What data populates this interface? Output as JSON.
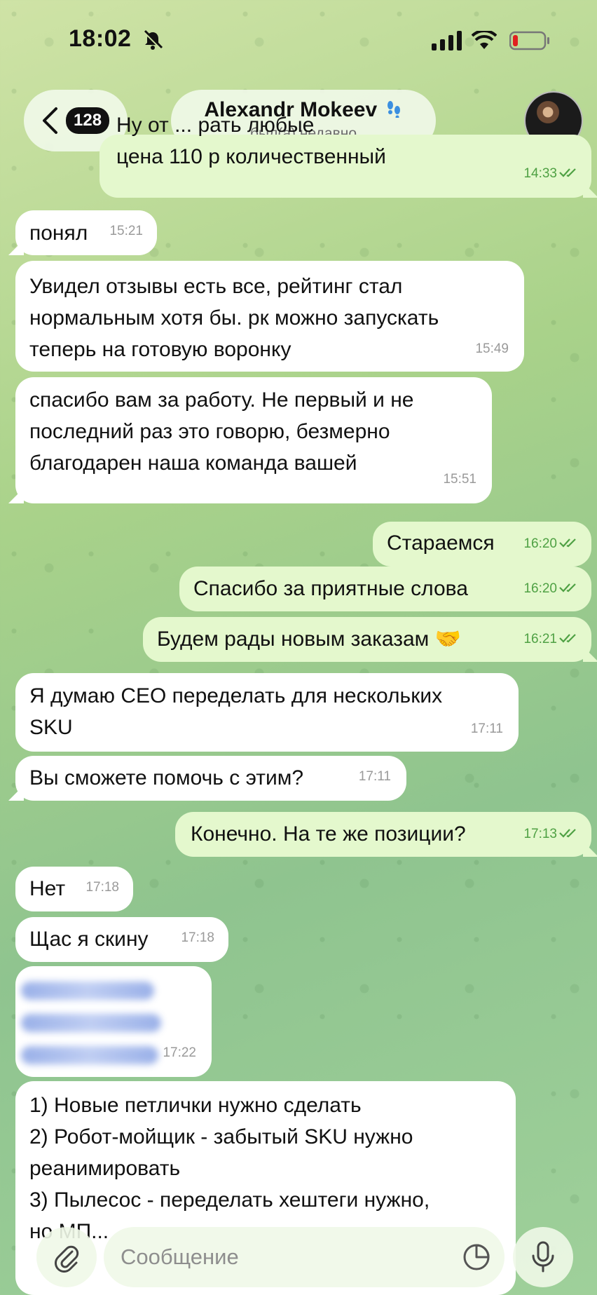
{
  "status_bar": {
    "time": "18:02"
  },
  "header": {
    "back_count": "128",
    "chat_name": "Alexandr Mokeev",
    "chat_status": "был(а) недавно"
  },
  "messages": [
    {
      "dir": "out",
      "text": "Ну от ... рать любые\nцена 110 р количественный",
      "time": "14:33"
    },
    {
      "dir": "in",
      "text": "понял",
      "time": "15:21"
    },
    {
      "dir": "in",
      "text": "Увидел отзывы есть все, рейтинг стал\nнормальным хотя бы. рк можно запускать\nтеперь на готовую воронку",
      "time": "15:49"
    },
    {
      "dir": "in",
      "text": "спасибо вам за работу. Не первый и не\nпоследний раз это говорю, безмерно\nблагодарен наша команда вашей",
      "time": "15:51"
    },
    {
      "dir": "out",
      "text": "Стараемся",
      "time": "16:20"
    },
    {
      "dir": "out",
      "text": "Спасибо за приятные слова",
      "time": "16:20"
    },
    {
      "dir": "out",
      "text": "Будем рады новым заказам 🤝",
      "time": "16:21"
    },
    {
      "dir": "in",
      "text": "Я думаю СЕО переделать для нескольких\nSKU",
      "time": "17:11"
    },
    {
      "dir": "in",
      "text": "Вы сможете помочь с этим?",
      "time": "17:11"
    },
    {
      "dir": "out",
      "text": "Конечно. На те же позиции?",
      "time": "17:13"
    },
    {
      "dir": "in",
      "text": "Нет",
      "time": "17:18"
    },
    {
      "dir": "in",
      "text": "Щас я скину",
      "time": "17:18"
    },
    {
      "dir": "in",
      "text": "",
      "time": "17:22"
    },
    {
      "dir": "in",
      "text": "1) Новые петлички нужно сделать\n2) Робот-мойщик - забытый SKU нужно\nреанимировать\n3) Пылесос - переделать хештеги нужно,\nно МП...",
      "time": ""
    }
  ],
  "input": {
    "placeholder": "Сообщение"
  },
  "colors": {
    "incoming": "#ffffff",
    "outgoing": "#e4f8cd",
    "out_time": "#4fa144"
  }
}
